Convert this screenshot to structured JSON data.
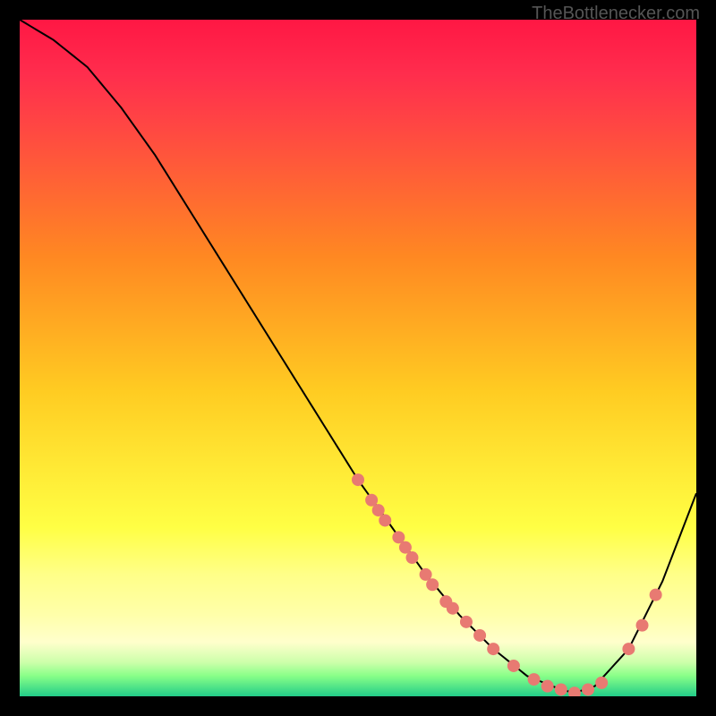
{
  "watermark": "TheBottlenecker.com",
  "chart_data": {
    "type": "line",
    "title": "",
    "xlabel": "",
    "ylabel": "",
    "xlim": [
      0,
      100
    ],
    "ylim": [
      0,
      100
    ],
    "series": [
      {
        "name": "curve",
        "x": [
          0,
          5,
          10,
          15,
          20,
          25,
          30,
          35,
          40,
          45,
          50,
          55,
          60,
          65,
          70,
          75,
          80,
          82,
          85,
          90,
          95,
          100
        ],
        "y": [
          100,
          97,
          93,
          87,
          80,
          72,
          64,
          56,
          48,
          40,
          32,
          25,
          18,
          12,
          7,
          3,
          1,
          0.5,
          1.5,
          7,
          17,
          30
        ]
      }
    ],
    "markers": [
      {
        "x": 50,
        "y": 32
      },
      {
        "x": 52,
        "y": 29
      },
      {
        "x": 53,
        "y": 27.5
      },
      {
        "x": 54,
        "y": 26
      },
      {
        "x": 56,
        "y": 23.5
      },
      {
        "x": 57,
        "y": 22
      },
      {
        "x": 58,
        "y": 20.5
      },
      {
        "x": 60,
        "y": 18
      },
      {
        "x": 61,
        "y": 16.5
      },
      {
        "x": 63,
        "y": 14
      },
      {
        "x": 64,
        "y": 13
      },
      {
        "x": 66,
        "y": 11
      },
      {
        "x": 68,
        "y": 9
      },
      {
        "x": 70,
        "y": 7
      },
      {
        "x": 73,
        "y": 4.5
      },
      {
        "x": 76,
        "y": 2.5
      },
      {
        "x": 78,
        "y": 1.5
      },
      {
        "x": 80,
        "y": 1
      },
      {
        "x": 82,
        "y": 0.5
      },
      {
        "x": 84,
        "y": 1
      },
      {
        "x": 86,
        "y": 2
      },
      {
        "x": 90,
        "y": 7
      },
      {
        "x": 92,
        "y": 10.5
      },
      {
        "x": 94,
        "y": 15
      }
    ],
    "background_gradient": {
      "top_color": "#ff1744",
      "mid_color": "#ffff44",
      "bottom_color": "#22cc88"
    },
    "marker_style": {
      "color": "#e87a72",
      "radius": 7
    },
    "line_style": {
      "color": "#000000",
      "width": 2
    }
  }
}
